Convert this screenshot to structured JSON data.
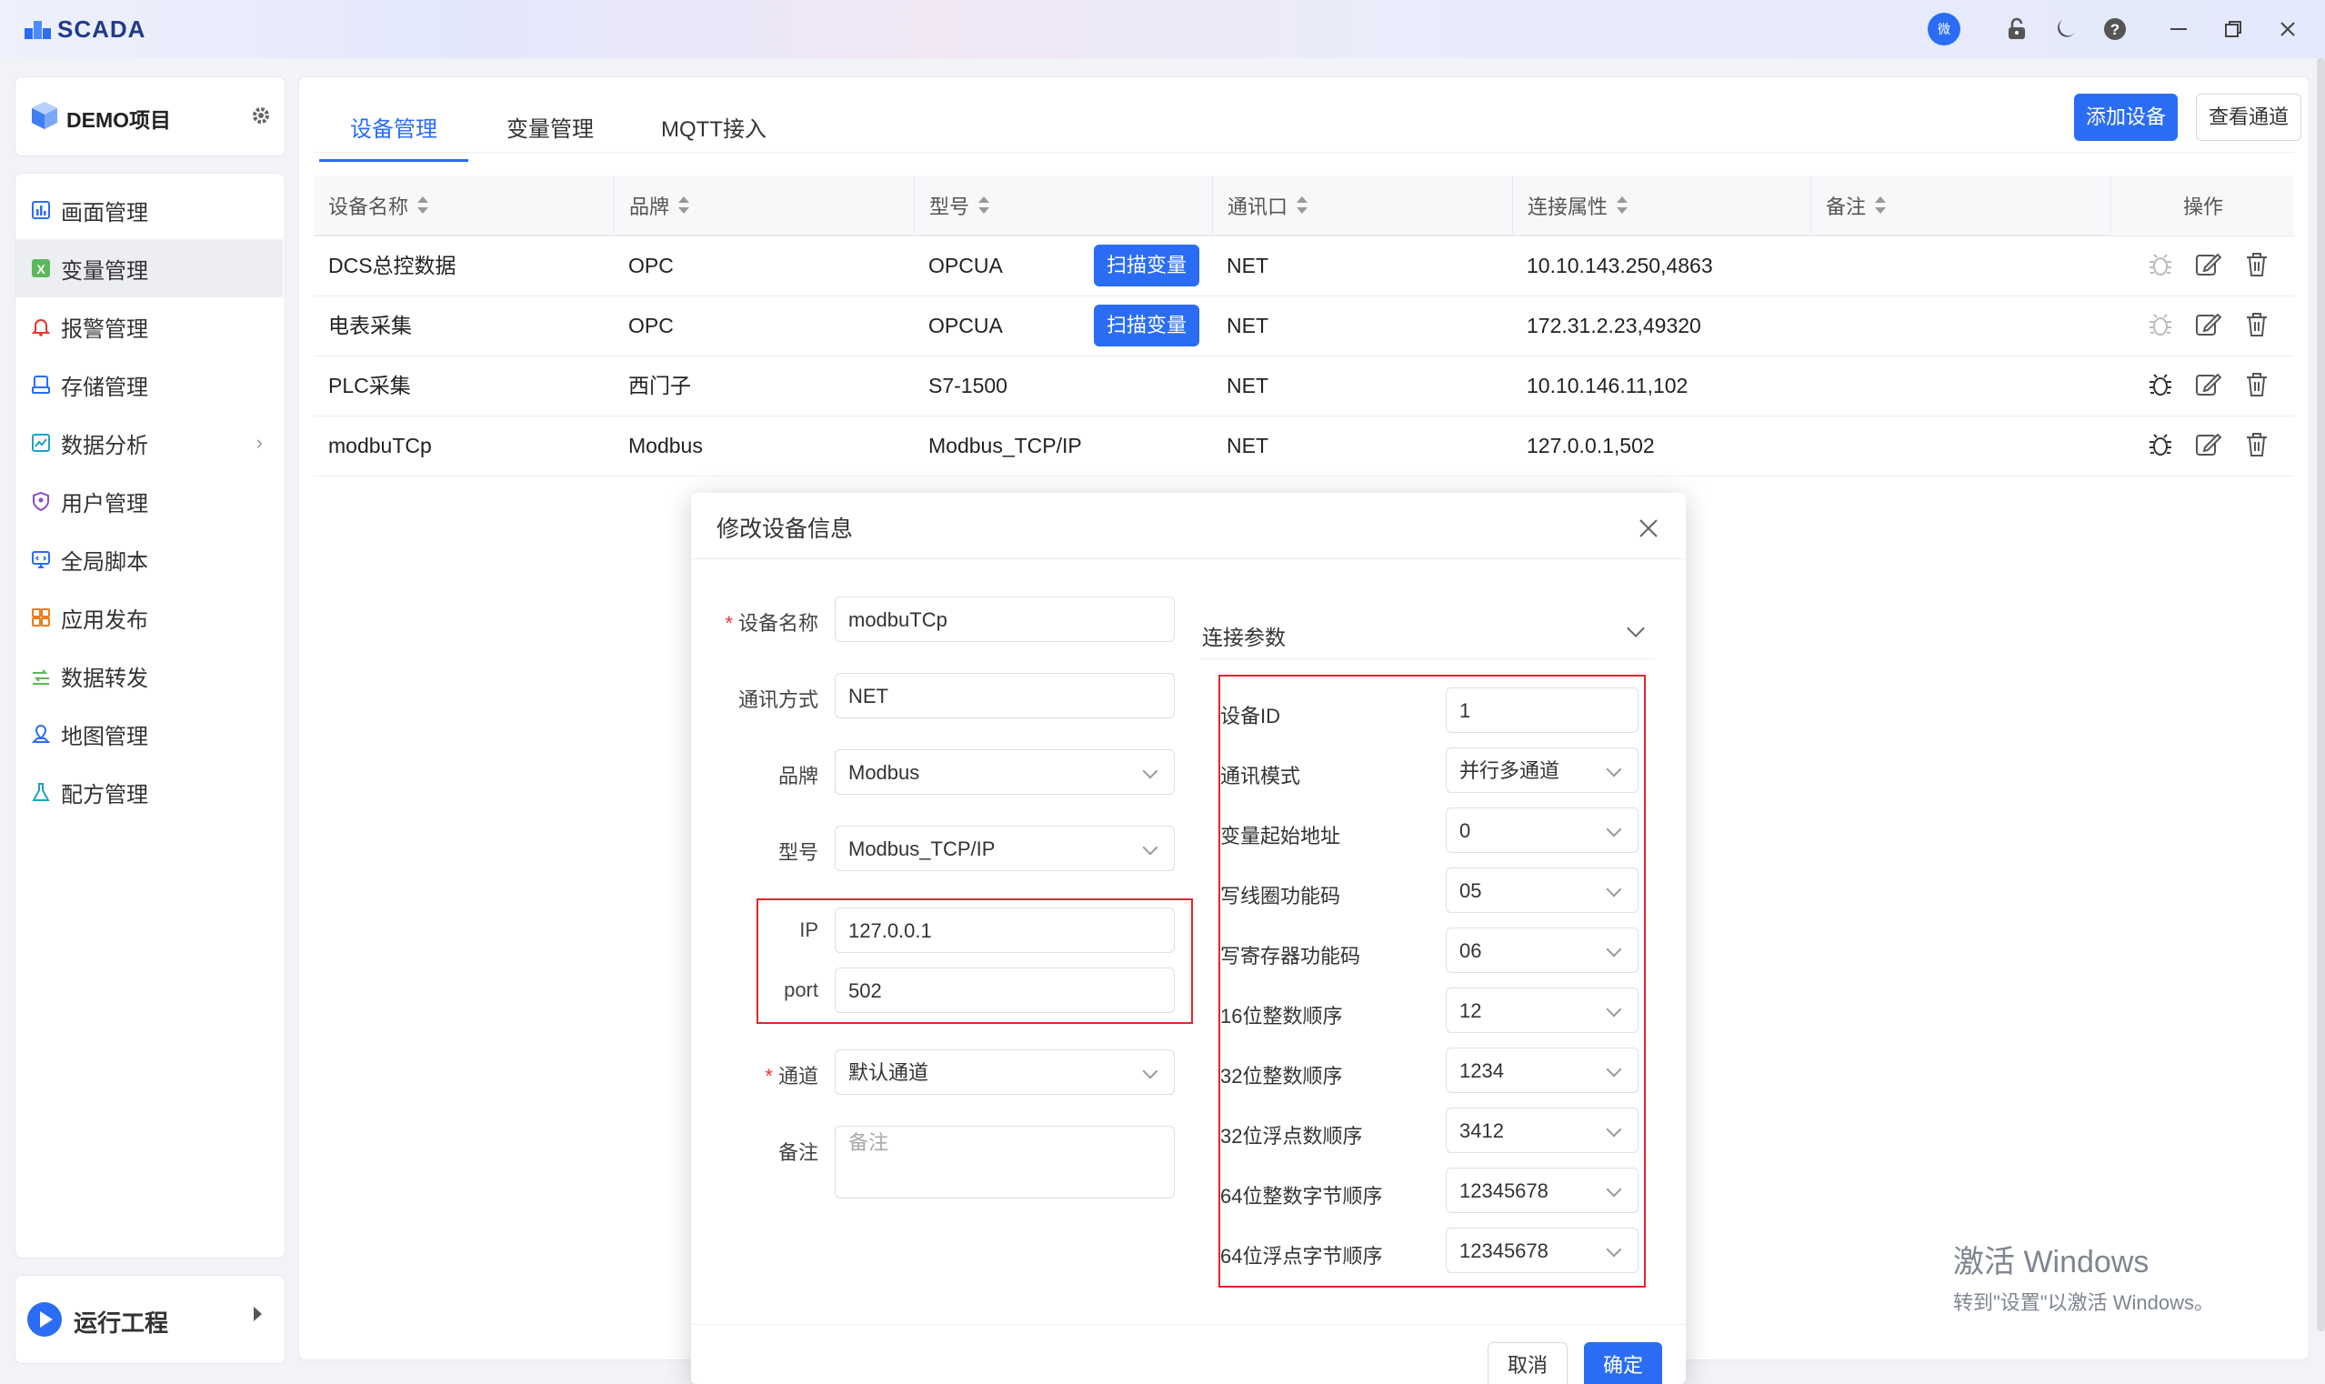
{
  "app": {
    "name": "SCADA",
    "avatar_text": "微"
  },
  "project": {
    "name": "DEMO项目"
  },
  "sidebar": {
    "items": [
      {
        "label": "画面管理",
        "icon": "chart-icon"
      },
      {
        "label": "变量管理",
        "icon": "variable-icon",
        "active": true
      },
      {
        "label": "报警管理",
        "icon": "bell-icon"
      },
      {
        "label": "存储管理",
        "icon": "storage-icon"
      },
      {
        "label": "数据分析",
        "icon": "analysis-icon",
        "arrow": "›"
      },
      {
        "label": "用户管理",
        "icon": "shield-icon"
      },
      {
        "label": "全局脚本",
        "icon": "script-icon"
      },
      {
        "label": "应用发布",
        "icon": "apps-icon"
      },
      {
        "label": "数据转发",
        "icon": "forward-icon"
      },
      {
        "label": "地图管理",
        "icon": "map-icon"
      },
      {
        "label": "配方管理",
        "icon": "flask-icon"
      }
    ],
    "run_label": "运行工程"
  },
  "tabs": [
    {
      "label": "设备管理",
      "active": true
    },
    {
      "label": "变量管理"
    },
    {
      "label": "MQTT接入"
    }
  ],
  "toolbar": {
    "add_device": "添加设备",
    "view_channel": "查看通道"
  },
  "table": {
    "columns": [
      "设备名称",
      "品牌",
      "型号",
      "通讯口",
      "连接属性",
      "备注",
      "操作"
    ],
    "scan_label": "扫描变量",
    "rows": [
      {
        "name": "DCS总控数据",
        "brand": "OPC",
        "model": "OPCUA",
        "port": "NET",
        "conn": "10.10.143.250,4863",
        "remark": "",
        "scan": true
      },
      {
        "name": "电表采集",
        "brand": "OPC",
        "model": "OPCUA",
        "port": "NET",
        "conn": "172.31.2.23,49320",
        "remark": "",
        "scan": true
      },
      {
        "name": "PLC采集",
        "brand": "西门子",
        "model": "S7-1500",
        "port": "NET",
        "conn": "10.10.146.11,102",
        "remark": "",
        "scan": false
      },
      {
        "name": "modbuTCp",
        "brand": "Modbus",
        "model": "Modbus_TCP/IP",
        "port": "NET",
        "conn": "127.0.0.1,502",
        "remark": "",
        "scan": false
      }
    ]
  },
  "dialog": {
    "title": "修改设备信息",
    "fields": {
      "name_label": "设备名称",
      "name_value": "modbuTCp",
      "comm_label": "通讯方式",
      "comm_value": "NET",
      "brand_label": "品牌",
      "brand_value": "Modbus",
      "model_label": "型号",
      "model_value": "Modbus_TCP/IP",
      "ip_label": "IP",
      "ip_value": "127.0.0.1",
      "port_label": "port",
      "port_value": "502",
      "channel_label": "通道",
      "channel_value": "默认通道",
      "remark_label": "备注",
      "remark_placeholder": "备注"
    },
    "params_title": "连接参数",
    "params": [
      {
        "label": "设备ID",
        "value": "1",
        "select": false
      },
      {
        "label": "通讯模式",
        "value": "并行多通道",
        "select": true
      },
      {
        "label": "变量起始地址",
        "value": "0",
        "select": true
      },
      {
        "label": "写线圈功能码",
        "value": "05",
        "select": true
      },
      {
        "label": "写寄存器功能码",
        "value": "06",
        "select": true
      },
      {
        "label": "16位整数顺序",
        "value": "12",
        "select": true
      },
      {
        "label": "32位整数顺序",
        "value": "1234",
        "select": true
      },
      {
        "label": "32位浮点数顺序",
        "value": "3412",
        "select": true
      },
      {
        "label": "64位整数字节顺序",
        "value": "12345678",
        "select": true
      },
      {
        "label": "64位浮点字节顺序",
        "value": "12345678",
        "select": true
      }
    ],
    "cancel": "取消",
    "ok": "确定"
  },
  "watermark": {
    "line1": "激活 Windows",
    "line2": "转到\"设置\"以激活 Windows。"
  }
}
